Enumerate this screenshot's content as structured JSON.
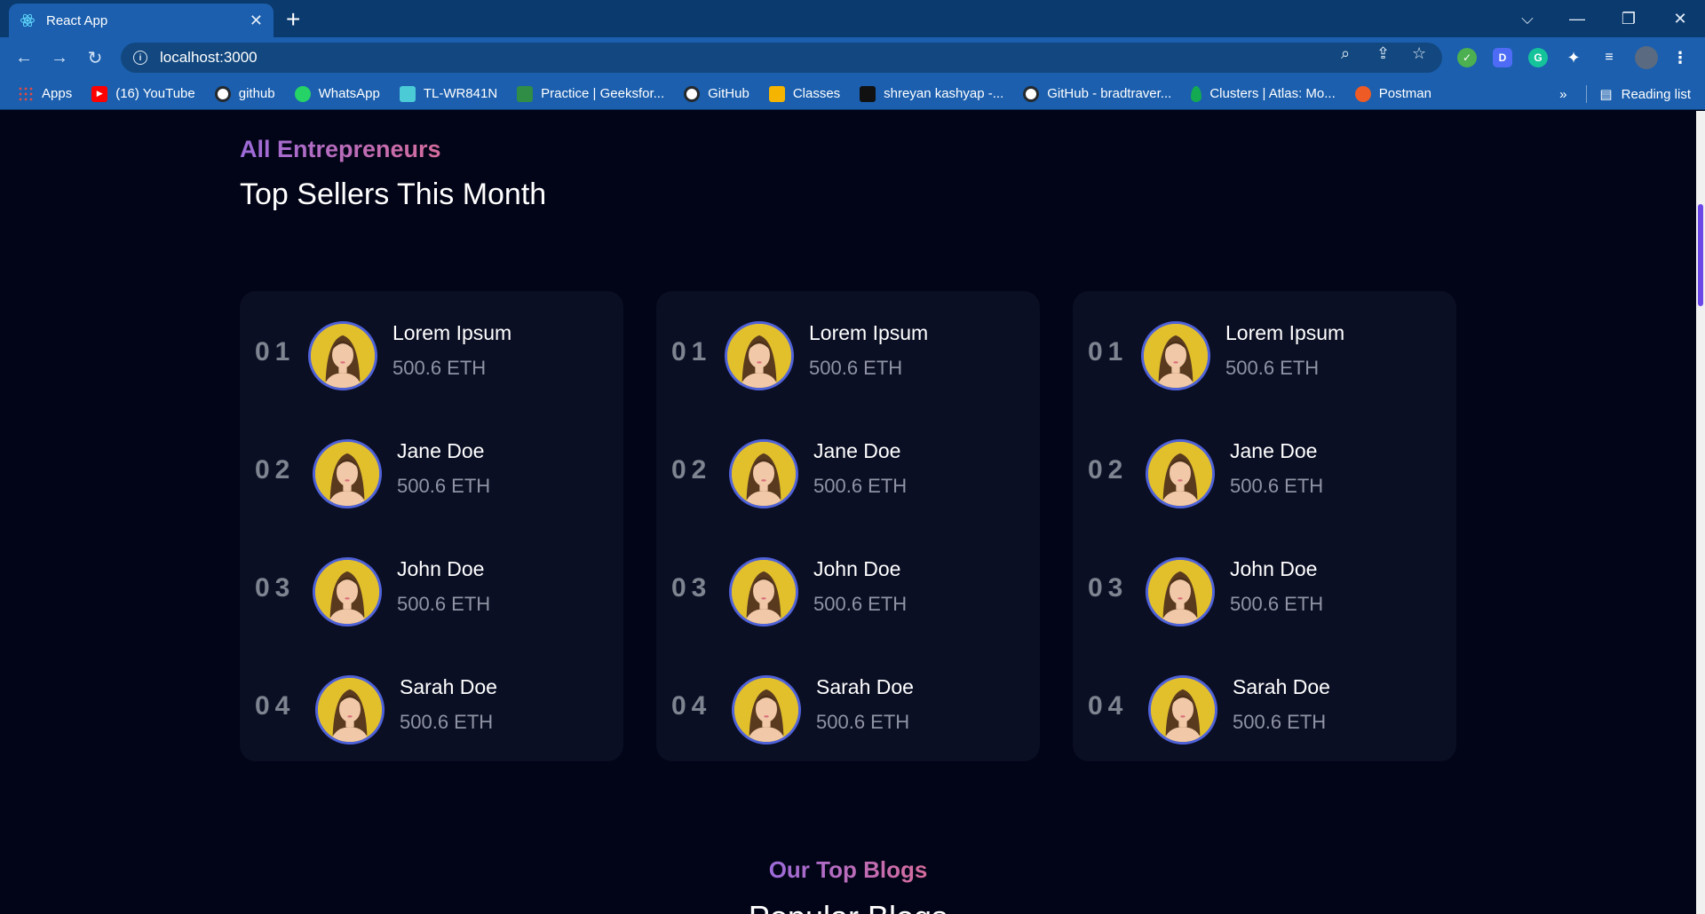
{
  "browser": {
    "tab_title": "React App",
    "address": "localhost:3000",
    "bookmarks": [
      {
        "label": "Apps",
        "icon": "apps-grid-icon",
        "color": "#e94a3f"
      },
      {
        "label": "(16) YouTube",
        "icon": "youtube-icon",
        "color": "#ff0000"
      },
      {
        "label": "github",
        "icon": "github-icon",
        "color": "#24292e"
      },
      {
        "label": "WhatsApp",
        "icon": "whatsapp-icon",
        "color": "#25d366"
      },
      {
        "label": "TL-WR841N",
        "icon": "tplink-icon",
        "color": "#4acbd6"
      },
      {
        "label": "Practice | Geeksfor...",
        "icon": "geeksforgeeks-icon",
        "color": "#2f8d46"
      },
      {
        "label": "GitHub",
        "icon": "github-icon",
        "color": "#24292e"
      },
      {
        "label": "Classes",
        "icon": "classroom-icon",
        "color": "#f4b400"
      },
      {
        "label": "shreyan kashyap -...",
        "icon": "hackerrank-icon",
        "color": "#111111"
      },
      {
        "label": "GitHub - bradtraver...",
        "icon": "github-icon",
        "color": "#24292e"
      },
      {
        "label": "Clusters | Atlas: Mo...",
        "icon": "mongodb-leaf-icon",
        "color": "#13aa52"
      },
      {
        "label": "Postman",
        "icon": "postman-icon",
        "color": "#ef5b25"
      }
    ],
    "overflow_label": "»",
    "reading_list": "Reading list"
  },
  "section": {
    "eyebrow": "All Entrepreneurs",
    "title": "Top Sellers This Month"
  },
  "sellers": [
    {
      "rank": "01",
      "name": "Lorem Ipsum",
      "amount": "500.6 ETH"
    },
    {
      "rank": "02",
      "name": "Jane Doe",
      "amount": "500.6 ETH"
    },
    {
      "rank": "03",
      "name": "John Doe",
      "amount": "500.6 ETH"
    },
    {
      "rank": "04",
      "name": "Sarah Doe",
      "amount": "500.6 ETH"
    }
  ],
  "blogs": {
    "eyebrow": "Our Top Blogs",
    "title": "Popular Blogs"
  },
  "colors": {
    "background": "#020417",
    "card": "#0b0f24",
    "accent_gradient": [
      "#9b6bd9",
      "#d66c9c"
    ],
    "avatar_ring": "#4f62d9"
  }
}
